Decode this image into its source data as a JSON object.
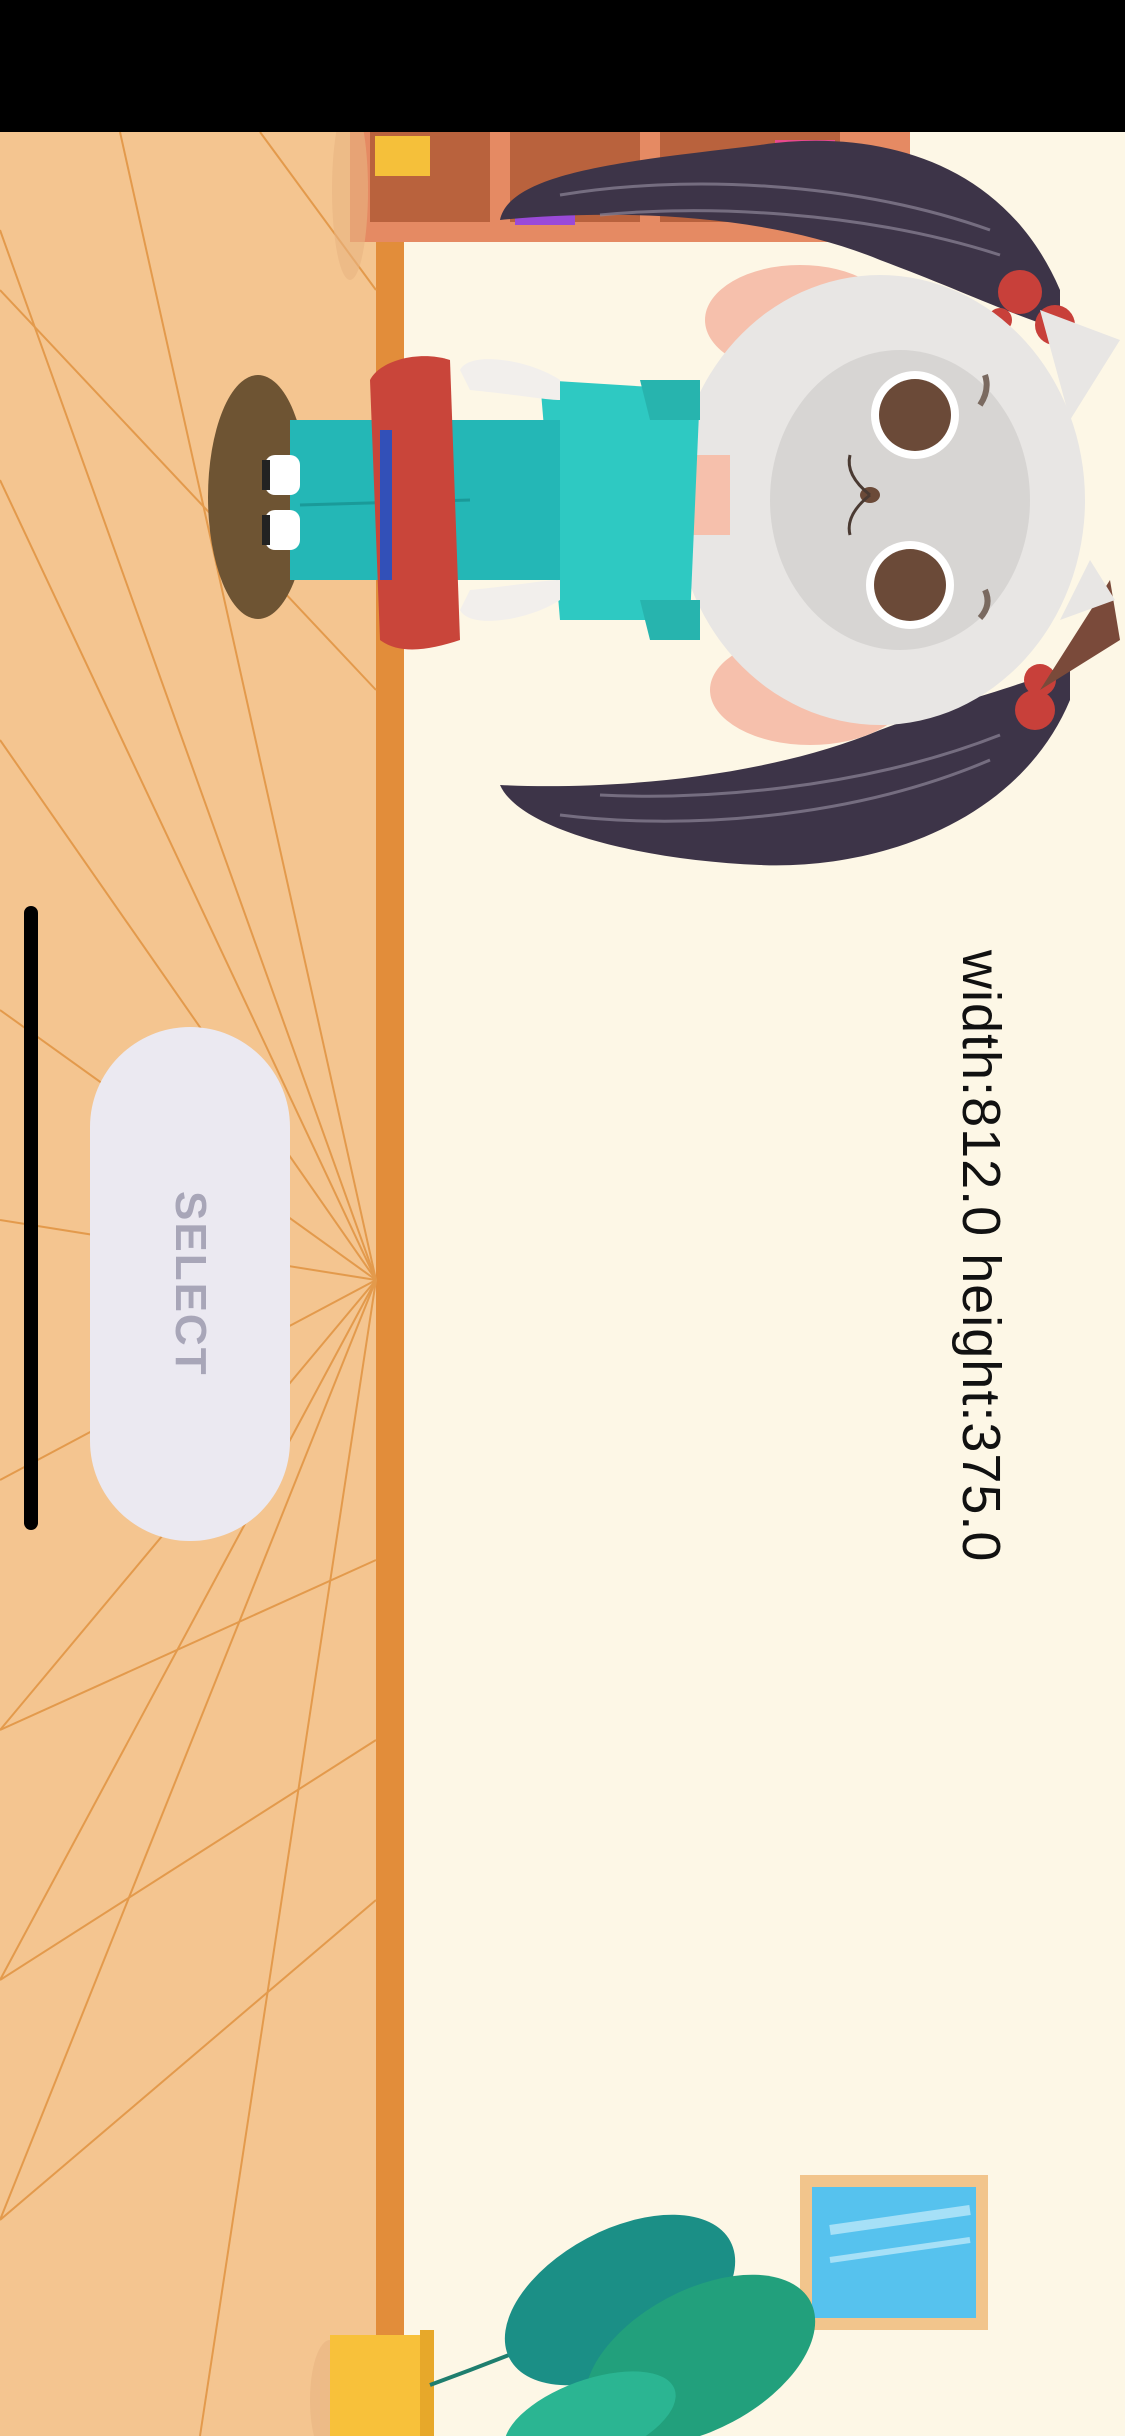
{
  "screen": {
    "orientation_note_text": "width:812.0 height:375.0"
  },
  "controls": {
    "select_label": "SELECT"
  },
  "character": {
    "name": "cat-character",
    "colors": {
      "fur": "#e8e6e4",
      "hair": "#3d3448",
      "shirt": "#2ec9c2",
      "skirt": "#c9453a",
      "bow": "#c8403a"
    }
  },
  "room": {
    "colors": {
      "wall": "#fdf7e6",
      "floor": "#f4c590",
      "floor_trim": "#e28d3a",
      "window_frame": "#f2c58c",
      "window_glass": "#56c2ee",
      "plant_leaf": "#1f9e8a",
      "pot": "#f8c13a"
    }
  }
}
